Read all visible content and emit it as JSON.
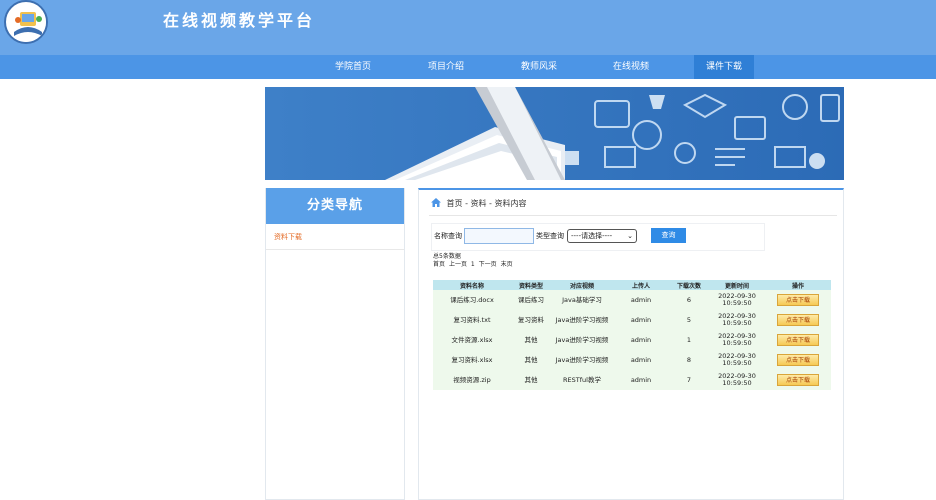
{
  "header": {
    "site_title": "在线视频教学平台"
  },
  "nav": {
    "items": [
      {
        "label": "学院首页"
      },
      {
        "label": "项目介绍"
      },
      {
        "label": "教师风采"
      },
      {
        "label": "在线视频"
      },
      {
        "label": "课件下载",
        "active": true
      }
    ]
  },
  "sidebar": {
    "title": "分类导航",
    "items": [
      {
        "label": "资料下载"
      }
    ]
  },
  "breadcrumb": {
    "text": "首页 - 资料 - 资料内容"
  },
  "search": {
    "name_label": "名称查询",
    "name_value": "",
    "type_label": "类型查询",
    "type_selected": "----请选择----",
    "query_label": "查询"
  },
  "summary": {
    "total": "总5条数据"
  },
  "pager": {
    "first": "首页",
    "prev": "上一页",
    "current": "1",
    "next": "下一页",
    "last": "末页"
  },
  "table": {
    "headers": [
      "资料名称",
      "资料类型",
      "对应视频",
      "上传人",
      "下载次数",
      "更新时间",
      "操作"
    ],
    "action_label": "点击下载",
    "rows": [
      {
        "name": "课后练习.docx",
        "type": "课后练习",
        "video": "Java基础学习",
        "uploader": "admin",
        "downloads": "6",
        "updated_date": "2022-09-30",
        "updated_time": "10:59:50"
      },
      {
        "name": "复习资料.txt",
        "type": "复习资料",
        "video": "Java进阶学习视频",
        "uploader": "admin",
        "downloads": "5",
        "updated_date": "2022-09-30",
        "updated_time": "10:59:50"
      },
      {
        "name": "文件资源.xlsx",
        "type": "其他",
        "video": "Java进阶学习视频",
        "uploader": "admin",
        "downloads": "1",
        "updated_date": "2022-09-30",
        "updated_time": "10:59:50"
      },
      {
        "name": "复习资料.xlsx",
        "type": "其他",
        "video": "Java进阶学习视频",
        "uploader": "admin",
        "downloads": "8",
        "updated_date": "2022-09-30",
        "updated_time": "10:59:50"
      },
      {
        "name": "视频资源.zip",
        "type": "其他",
        "video": "RESTful教学",
        "uploader": "admin",
        "downloads": "7",
        "updated_date": "2022-09-30",
        "updated_time": "10:59:50"
      }
    ]
  }
}
